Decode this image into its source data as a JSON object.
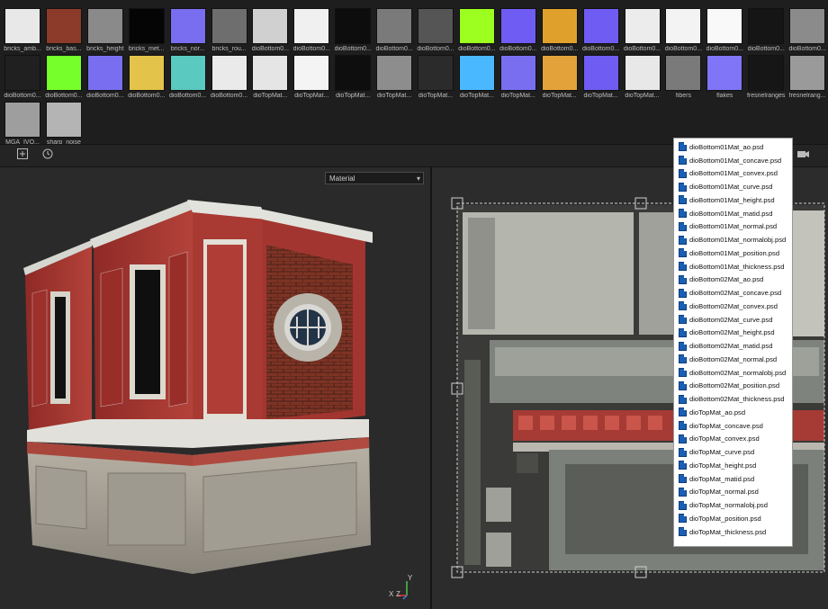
{
  "shelf": {
    "row1": [
      {
        "label": "bricks_amb...",
        "icon": "bricks-ambient-texture"
      },
      {
        "label": "bricks_bas...",
        "icon": "bricks-basecolor-texture"
      },
      {
        "label": "bricks_height",
        "icon": "bricks-height-texture"
      },
      {
        "label": "bricks_met...",
        "icon": "bricks-metallic-texture"
      },
      {
        "label": "bricks_nor...",
        "icon": "bricks-normal-texture"
      },
      {
        "label": "bricks_rou...",
        "icon": "bricks-roughness-texture"
      },
      {
        "label": "dioBottom0...",
        "icon": "texture-thumbnail"
      },
      {
        "label": "dioBottom0...",
        "icon": "texture-thumbnail"
      },
      {
        "label": "dioBottom0...",
        "icon": "texture-thumbnail"
      },
      {
        "label": "dioBottom0...",
        "icon": "texture-thumbnail"
      },
      {
        "label": "dioBottom0...",
        "icon": "texture-thumbnail"
      },
      {
        "label": "dioBottom0...",
        "icon": "texture-thumbnail"
      },
      {
        "label": "dioBottom0...",
        "icon": "texture-thumbnail"
      },
      {
        "label": "dioBottom0...",
        "icon": "texture-thumbnail"
      },
      {
        "label": "dioBottom0...",
        "icon": "texture-thumbnail"
      },
      {
        "label": "dioBottom0...",
        "icon": "texture-thumbnail"
      },
      {
        "label": "dioBottom0...",
        "icon": "texture-thumbnail"
      },
      {
        "label": "dioBottom0...",
        "icon": "texture-thumbnail"
      },
      {
        "label": "dioBottom0...",
        "icon": "texture-thumbnail"
      },
      {
        "label": "dioBottom0...",
        "icon": "texture-thumbnail"
      }
    ],
    "row2": [
      {
        "label": "dioBottom0...",
        "icon": "texture-thumbnail"
      },
      {
        "label": "dioBottom0...",
        "icon": "texture-thumbnail"
      },
      {
        "label": "dioBottom0...",
        "icon": "texture-thumbnail"
      },
      {
        "label": "dioBottom0...",
        "icon": "texture-thumbnail"
      },
      {
        "label": "dioBottom0...",
        "icon": "texture-thumbnail"
      },
      {
        "label": "dioBottom0...",
        "icon": "texture-thumbnail"
      },
      {
        "label": "dioTopMat...",
        "icon": "texture-thumbnail"
      },
      {
        "label": "dioTopMat...",
        "icon": "texture-thumbnail"
      },
      {
        "label": "dioTopMat...",
        "icon": "texture-thumbnail"
      },
      {
        "label": "dioTopMat...",
        "icon": "texture-thumbnail"
      },
      {
        "label": "dioTopMat...",
        "icon": "texture-thumbnail"
      },
      {
        "label": "dioTopMat...",
        "icon": "texture-thumbnail"
      },
      {
        "label": "dioTopMat...",
        "icon": "texture-thumbnail"
      },
      {
        "label": "dioTopMat...",
        "icon": "texture-thumbnail"
      },
      {
        "label": "dioTopMat...",
        "icon": "texture-thumbnail"
      },
      {
        "label": "dioTopMat...",
        "icon": "texture-thumbnail"
      },
      {
        "label": "fibers",
        "icon": "fibers-texture"
      },
      {
        "label": "flakes",
        "icon": "flakes-texture"
      },
      {
        "label": "fresnelranges",
        "icon": "fresnel-texture"
      },
      {
        "label": "fresnelrang...",
        "icon": "fresnel-texture"
      }
    ],
    "row3": [
      {
        "label": "MGA_IVO...",
        "icon": "noise-texture"
      },
      {
        "label": "sharp_noise",
        "icon": "sharp-noise-texture"
      }
    ]
  },
  "toolbar": {
    "add_icon": "plus-square-icon",
    "history_icon": "history-icon",
    "cube_icon": "cube-icon",
    "camera_icon": "camera-icon"
  },
  "viewport3d": {
    "mode": "Material",
    "axis_x": "X",
    "axis_z": "Z",
    "axis_y": "Y"
  },
  "filelist": {
    "items": [
      "dioBottom01Mat_ao.psd",
      "dioBottom01Mat_concave.psd",
      "dioBottom01Mat_convex.psd",
      "dioBottom01Mat_curve.psd",
      "dioBottom01Mat_height.psd",
      "dioBottom01Mat_matid.psd",
      "dioBottom01Mat_normal.psd",
      "dioBottom01Mat_normalobj.psd",
      "dioBottom01Mat_position.psd",
      "dioBottom01Mat_thickness.psd",
      "dioBottom02Mat_ao.psd",
      "dioBottom02Mat_concave.psd",
      "dioBottom02Mat_convex.psd",
      "dioBottom02Mat_curve.psd",
      "dioBottom02Mat_height.psd",
      "dioBottom02Mat_matid.psd",
      "dioBottom02Mat_normal.psd",
      "dioBottom02Mat_normalobj.psd",
      "dioBottom02Mat_position.psd",
      "dioBottom02Mat_thickness.psd",
      "dioTopMat_ao.psd",
      "dioTopMat_concave.psd",
      "dioTopMat_convex.psd",
      "dioTopMat_curve.psd",
      "dioTopMat_height.psd",
      "dioTopMat_matid.psd",
      "dioTopMat_normal.psd",
      "dioTopMat_normalobj.psd",
      "dioTopMat_position.psd",
      "dioTopMat_thickness.psd"
    ]
  }
}
